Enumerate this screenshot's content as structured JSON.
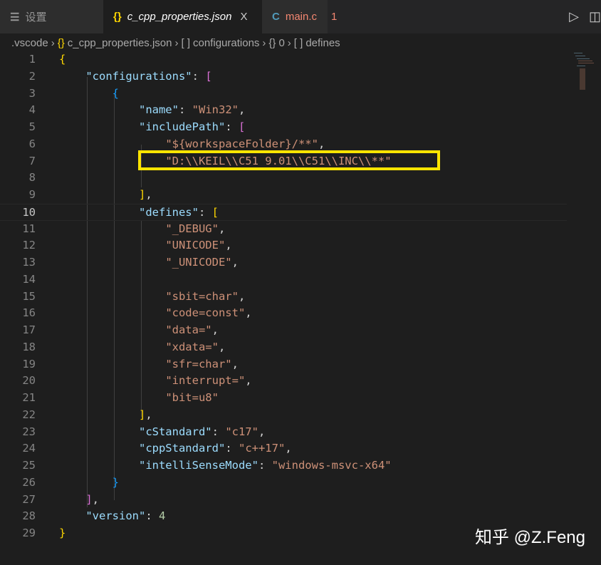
{
  "tabs": [
    {
      "label": "设置",
      "icon": "settings-lines-icon"
    },
    {
      "label": "c_cpp_properties.json",
      "icon": "{}",
      "close": "X"
    },
    {
      "label": "main.c",
      "icon": "C",
      "badge": "1"
    }
  ],
  "breadcrumb": [
    ".vscode",
    "{}",
    "c_cpp_properties.json",
    "[ ]",
    "configurations",
    "{}",
    "0",
    "[ ]",
    "defines"
  ],
  "watermark": "知乎 @Z.Feng",
  "current_line": 10,
  "highlighted_line": 7,
  "code": [
    [
      [
        "{",
        "b1"
      ]
    ],
    [
      [
        "    ",
        ""
      ],
      [
        "\"configurations\"",
        "k"
      ],
      [
        ": ",
        "p"
      ],
      [
        "[",
        "b2"
      ]
    ],
    [
      [
        "        ",
        ""
      ],
      [
        "{",
        "b3"
      ]
    ],
    [
      [
        "            ",
        ""
      ],
      [
        "\"name\"",
        "k"
      ],
      [
        ": ",
        "p"
      ],
      [
        "\"Win32\"",
        "s"
      ],
      [
        ",",
        "p"
      ]
    ],
    [
      [
        "            ",
        ""
      ],
      [
        "\"includePath\"",
        "k"
      ],
      [
        ": ",
        "p"
      ],
      [
        "[",
        "b2"
      ]
    ],
    [
      [
        "                ",
        ""
      ],
      [
        "\"${workspaceFolder}/**\"",
        "s"
      ],
      [
        ",",
        "p"
      ]
    ],
    [
      [
        "                ",
        ""
      ],
      [
        "\"D:\\\\KEIL\\\\C51 9.01\\\\C51\\\\INC\\\\**\"",
        "s"
      ]
    ],
    [],
    [
      [
        "            ",
        ""
      ],
      [
        "]",
        "b1"
      ],
      [
        ",",
        "p"
      ]
    ],
    [
      [
        "            ",
        ""
      ],
      [
        "\"defines\"",
        "k"
      ],
      [
        ": ",
        "p"
      ],
      [
        "[",
        "b1"
      ]
    ],
    [
      [
        "                ",
        ""
      ],
      [
        "\"_DEBUG\"",
        "s"
      ],
      [
        ",",
        "p"
      ]
    ],
    [
      [
        "                ",
        ""
      ],
      [
        "\"UNICODE\"",
        "s"
      ],
      [
        ",",
        "p"
      ]
    ],
    [
      [
        "                ",
        ""
      ],
      [
        "\"_UNICODE\"",
        "s"
      ],
      [
        ",",
        "p"
      ]
    ],
    [],
    [
      [
        "                ",
        ""
      ],
      [
        "\"sbit=char\"",
        "s"
      ],
      [
        ",",
        "p"
      ]
    ],
    [
      [
        "                ",
        ""
      ],
      [
        "\"code=const\"",
        "s"
      ],
      [
        ",",
        "p"
      ]
    ],
    [
      [
        "                ",
        ""
      ],
      [
        "\"data=\"",
        "s"
      ],
      [
        ",",
        "p"
      ]
    ],
    [
      [
        "                ",
        ""
      ],
      [
        "\"xdata=\"",
        "s"
      ],
      [
        ",",
        "p"
      ]
    ],
    [
      [
        "                ",
        ""
      ],
      [
        "\"sfr=char\"",
        "s"
      ],
      [
        ",",
        "p"
      ]
    ],
    [
      [
        "                ",
        ""
      ],
      [
        "\"interrupt=\"",
        "s"
      ],
      [
        ",",
        "p"
      ]
    ],
    [
      [
        "                ",
        ""
      ],
      [
        "\"bit=u8\"",
        "s"
      ]
    ],
    [
      [
        "            ",
        ""
      ],
      [
        "]",
        "b1"
      ],
      [
        ",",
        "p"
      ]
    ],
    [
      [
        "            ",
        ""
      ],
      [
        "\"cStandard\"",
        "k"
      ],
      [
        ": ",
        "p"
      ],
      [
        "\"c17\"",
        "s"
      ],
      [
        ",",
        "p"
      ]
    ],
    [
      [
        "            ",
        ""
      ],
      [
        "\"cppStandard\"",
        "k"
      ],
      [
        ": ",
        "p"
      ],
      [
        "\"c++17\"",
        "s"
      ],
      [
        ",",
        "p"
      ]
    ],
    [
      [
        "            ",
        ""
      ],
      [
        "\"intelliSenseMode\"",
        "k"
      ],
      [
        ": ",
        "p"
      ],
      [
        "\"windows-msvc-x64\"",
        "s"
      ]
    ],
    [
      [
        "        ",
        ""
      ],
      [
        "}",
        "b3"
      ]
    ],
    [
      [
        "    ",
        ""
      ],
      [
        "]",
        "b2"
      ],
      [
        ",",
        "p"
      ]
    ],
    [
      [
        "    ",
        ""
      ],
      [
        "\"version\"",
        "k"
      ],
      [
        ": ",
        "p"
      ],
      [
        "4",
        "n"
      ]
    ],
    [
      [
        "}",
        "b1"
      ]
    ]
  ]
}
